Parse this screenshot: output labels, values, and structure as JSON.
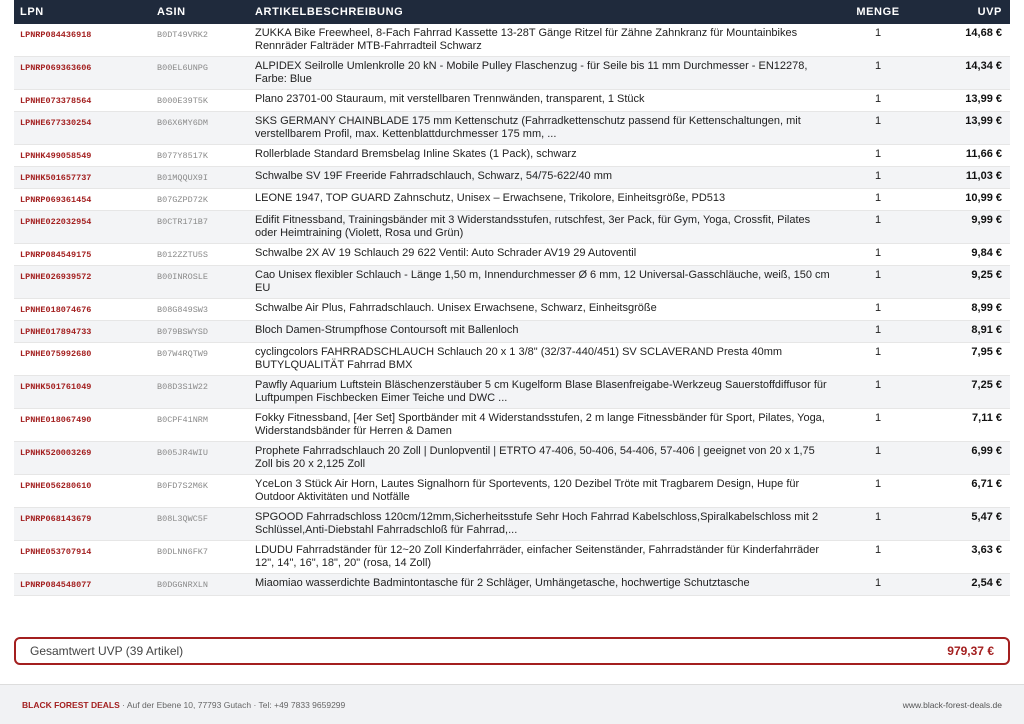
{
  "table": {
    "headers": {
      "lpn": "LPN",
      "asin": "ASIN",
      "desc": "ARTIKELBESCHREIBUNG",
      "menge": "MENGE",
      "uvp": "UVP"
    },
    "rows": [
      {
        "lpn": "LPNRP084436918",
        "asin": "B0DT49VRK2",
        "desc": "ZUKKA Bike Freewheel, 8-Fach Fahrrad Kassette 13-28T Gänge Ritzel für Zähne Zahnkranz für Mountainbikes Rennräder Falträder MTB-Fahrradteil Schwarz",
        "menge": "1",
        "uvp": "14,68 €"
      },
      {
        "lpn": "LPNRP069363606",
        "asin": "B00EL6UNPG",
        "desc": "ALPIDEX Seilrolle Umlenkrolle 20 kN - Mobile Pulley Flaschenzug - für Seile bis 11 mm Durchmesser - EN12278, Farbe: Blue",
        "menge": "1",
        "uvp": "14,34 €"
      },
      {
        "lpn": "LPNHE073378564",
        "asin": "B000E39T5K",
        "desc": "Plano 23701-00 Stauraum, mit verstellbaren Trennwänden, transparent, 1 Stück",
        "menge": "1",
        "uvp": "13,99 €"
      },
      {
        "lpn": "LPNHE677330254",
        "asin": "B06X6MY6DM",
        "desc": "SKS GERMANY CHAINBLADE 175 mm Kettenschutz (Fahrradkettenschutz passend für Kettenschaltungen, mit verstellbarem Profil, max. Kettenblattdurchmesser 175 mm, ...",
        "menge": "1",
        "uvp": "13,99 €"
      },
      {
        "lpn": "LPNHK499058549",
        "asin": "B077Y8517K",
        "desc": "Rollerblade Standard Bremsbelag Inline Skates (1 Pack), schwarz",
        "menge": "1",
        "uvp": "11,66 €"
      },
      {
        "lpn": "LPNHK501657737",
        "asin": "B01MQQUX9I",
        "desc": "Schwalbe SV 19F Freeride Fahrradschlauch, Schwarz, 54/75-622/40 mm",
        "menge": "1",
        "uvp": "11,03 €"
      },
      {
        "lpn": "LPNRP069361454",
        "asin": "B07GZPD72K",
        "desc": "LEONE 1947, TOP GUARD Zahnschutz, Unisex – Erwachsene, Trikolore, Einheitsgröße, PD513",
        "menge": "1",
        "uvp": "10,99 €"
      },
      {
        "lpn": "LPNHE022032954",
        "asin": "B0CTR171B7",
        "desc": "Edifit Fitnessband, Trainingsbänder mit 3 Widerstandsstufen, rutschfest, 3er Pack, für Gym, Yoga, Crossfit, Pilates oder Heimtraining (Violett, Rosa und Grün)",
        "menge": "1",
        "uvp": "9,99 €"
      },
      {
        "lpn": "LPNRP084549175",
        "asin": "B012ZZTU5S",
        "desc": "Schwalbe 2X AV 19 Schlauch 29 622 Ventil: Auto Schrader AV19 29 Autoventil",
        "menge": "1",
        "uvp": "9,84 €"
      },
      {
        "lpn": "LPNHE026939572",
        "asin": "B00INROSLE",
        "desc": "Cao Unisex flexibler Schlauch - Länge 1,50 m, Innendurchmesser Ø 6 mm, 12 Universal-Gasschläuche, weiß, 150 cm EU",
        "menge": "1",
        "uvp": "9,25 €"
      },
      {
        "lpn": "LPNHE018074676",
        "asin": "B08G849SW3",
        "desc": "Schwalbe Air Plus, Fahrradschlauch. Unisex Erwachsene, Schwarz, Einheitsgröße",
        "menge": "1",
        "uvp": "8,99 €"
      },
      {
        "lpn": "LPNHE017894733",
        "asin": "B079BSWYSD",
        "desc": "Bloch Damen-Strumpfhose Contoursoft mit Ballenloch",
        "menge": "1",
        "uvp": "8,91 €"
      },
      {
        "lpn": "LPNHE075992680",
        "asin": "B07W4RQTW9",
        "desc": "cyclingcolors FAHRRADSCHLAUCH Schlauch 20 x 1 3/8\" (32/37-440/451) SV SCLAVERAND Presta 40mm BUTYLQUALITÄT Fahrrad BMX",
        "menge": "1",
        "uvp": "7,95 €"
      },
      {
        "lpn": "LPNHK501761049",
        "asin": "B08D3S1W22",
        "desc": "Pawfly Aquarium Luftstein Bläschenzerstäuber 5 cm Kugelform Blase Blasenfreigabe-Werkzeug Sauerstoffdiffusor für Luftpumpen Fischbecken Eimer Teiche und DWC ...",
        "menge": "1",
        "uvp": "7,25 €"
      },
      {
        "lpn": "LPNHE018067490",
        "asin": "B0CPF41NRM",
        "desc": "Fokky Fitnessband, [4er Set] Sportbänder mit 4 Widerstandsstufen, 2 m lange Fitnessbänder für Sport, Pilates, Yoga, Widerstandsbänder für Herren & Damen",
        "menge": "1",
        "uvp": "7,11 €"
      },
      {
        "lpn": "LPNHK520003269",
        "asin": "B005JR4WIU",
        "desc": "Prophete Fahrradschlauch 20 Zoll | Dunlopventil | ETRTO 47-406, 50-406, 54-406, 57-406 | geeignet von 20 x 1,75 Zoll bis 20 x 2,125 Zoll",
        "menge": "1",
        "uvp": "6,99 €"
      },
      {
        "lpn": "LPNHE056280610",
        "asin": "B0FD7S2M6K",
        "desc": "YceLon 3 Stück Air Horn, Lautes Signalhorn für Sportevents, 120 Dezibel Tröte mit Tragbarem Design, Hupe für Outdoor Aktivitäten und Notfälle",
        "menge": "1",
        "uvp": "6,71 €"
      },
      {
        "lpn": "LPNRP068143679",
        "asin": "B08L3QWC5F",
        "desc": "SPGOOD Fahrradschloss 120cm/12mm,Sicherheitsstufe Sehr Hoch Fahrrad Kabelschloss,Spiralkabelschloss mit 2 Schlüssel,Anti-Diebstahl Fahrradschloß für Fahrrad,...",
        "menge": "1",
        "uvp": "5,47 €"
      },
      {
        "lpn": "LPNHE053707914",
        "asin": "B0DLNN6FK7",
        "desc": "LDUDU Fahrradständer für 12~20 Zoll Kinderfahrräder, einfacher Seitenständer, Fahrradständer für Kinderfahrräder 12\", 14\", 16\", 18\", 20\" (rosa, 14 Zoll)",
        "menge": "1",
        "uvp": "3,63 €"
      },
      {
        "lpn": "LPNRP084548077",
        "asin": "B0DGGNRXLN",
        "desc": "Miaomiao wasserdichte Badmintontasche für 2 Schläger, Umhängetasche, hochwertige Schutztasche",
        "menge": "1",
        "uvp": "2,54 €"
      }
    ]
  },
  "total": {
    "label": "Gesamtwert UVP (39 Artikel)",
    "value": "979,37 €"
  },
  "footer": {
    "brand": "BLACK FOREST DEALS",
    "meta": " · Auf der Ebene 10, 77793 Gutach · Tel: +49 7833 9659299",
    "website": "www.black-forest-deals.de"
  },
  "colors": {
    "header_bg": "#1f2a3c",
    "accent": "#a31f1f"
  }
}
